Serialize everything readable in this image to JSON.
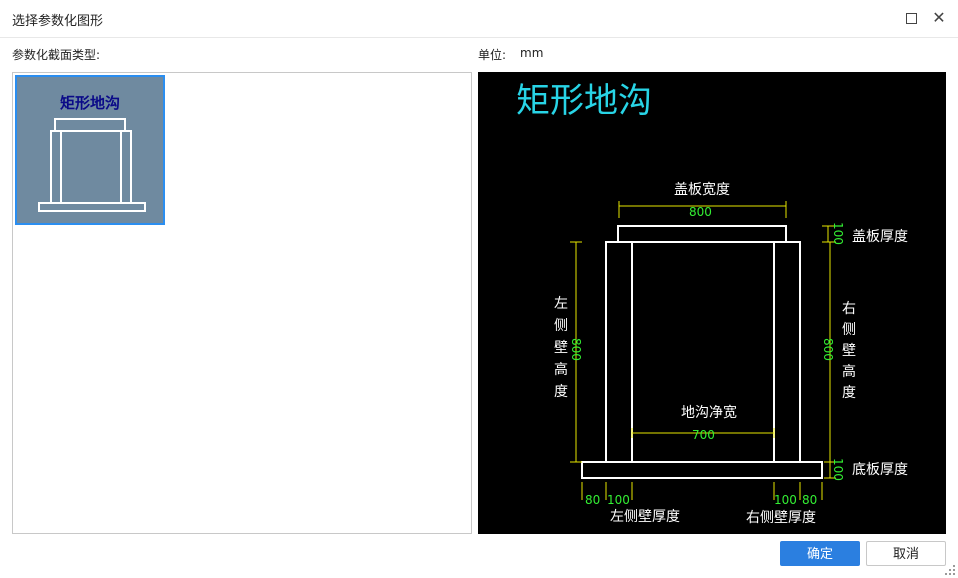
{
  "dialog": {
    "title": "选择参数化图形",
    "section_label": "参数化截面类型:",
    "unit_label": "单位:",
    "unit_value": "mm"
  },
  "thumbnails": [
    {
      "title": "矩形地沟",
      "selected": true
    }
  ],
  "preview": {
    "heading": "矩形地沟",
    "labels": {
      "cover_width": "盖板宽度",
      "cover_thickness": "盖板厚度",
      "left_wall_height": [
        "左",
        "侧",
        "壁",
        "高",
        "度"
      ],
      "right_wall_height": [
        "右",
        "侧",
        "壁",
        "高",
        "度"
      ],
      "net_width": "地沟净宽",
      "bottom_thickness": "底板厚度",
      "left_wall_thickness": "左侧壁厚度",
      "right_wall_thickness": "右侧壁厚度"
    },
    "dims": {
      "cover_width": "800",
      "cover_thickness": "100",
      "left_wall_height": "800",
      "right_wall_height": "800",
      "net_width": "700",
      "bottom_thickness": "100",
      "left_offset_a": "80",
      "left_offset_b": "100",
      "right_offset_a": "100",
      "right_offset_b": "80"
    },
    "colors": {
      "background": "#000000",
      "heading": "#28d4e6",
      "label": "#ffffff",
      "dimension_text": "#33ee33",
      "dimension_line": "#e6e600",
      "shape": "#ffffff"
    }
  },
  "buttons": {
    "ok": "确定",
    "cancel": "取消"
  }
}
